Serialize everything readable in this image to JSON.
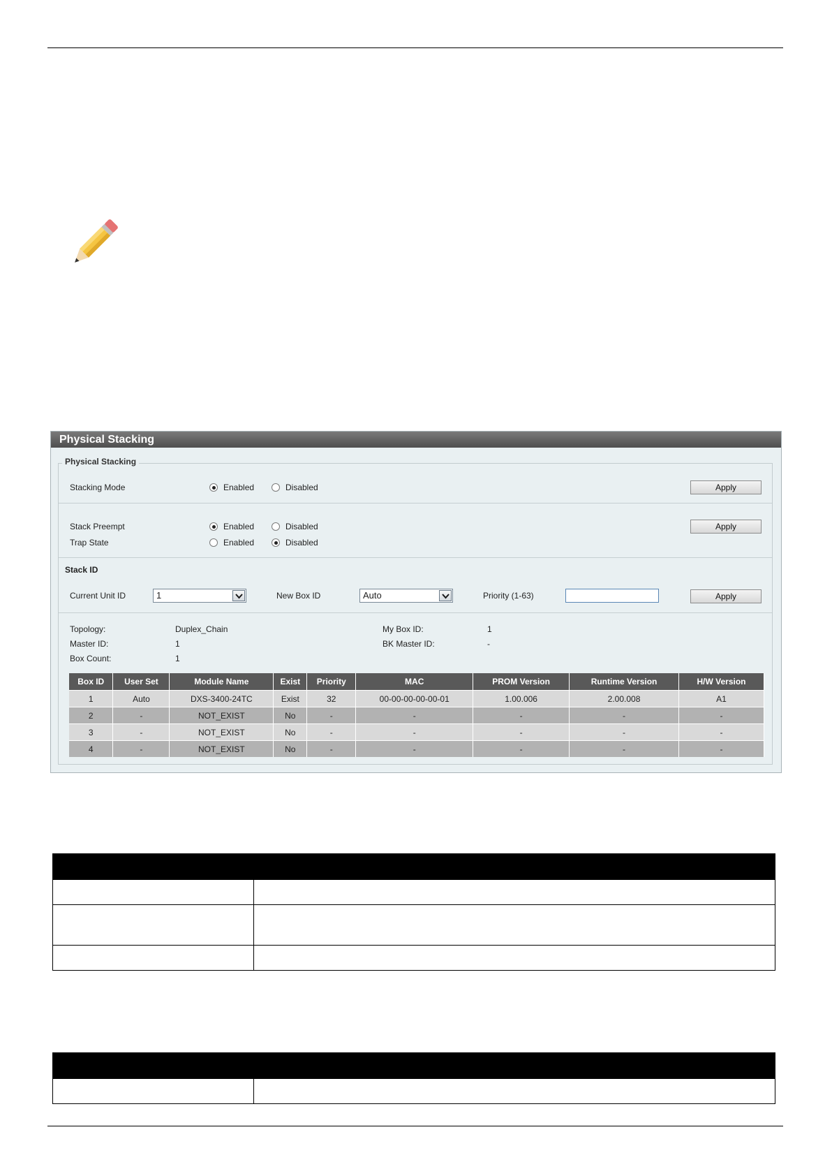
{
  "panel": {
    "title": "Physical Stacking",
    "legend": "Physical Stacking",
    "stacking_mode": {
      "label": "Stacking Mode",
      "enabled": "Enabled",
      "disabled": "Disabled",
      "selected": "Enabled",
      "apply": "Apply"
    },
    "stack_preempt": {
      "label": "Stack Preempt",
      "enabled": "Enabled",
      "disabled": "Disabled",
      "selected": "Enabled"
    },
    "trap_state": {
      "label": "Trap State",
      "enabled": "Enabled",
      "disabled": "Disabled",
      "selected": "Disabled"
    },
    "preempt_apply": "Apply",
    "stack_id": {
      "heading": "Stack ID",
      "current_unit_label": "Current Unit ID",
      "current_unit_value": "1",
      "new_box_label": "New Box ID",
      "new_box_value": "Auto",
      "priority_label": "Priority (1-63)",
      "priority_value": "",
      "apply": "Apply"
    },
    "info": {
      "topology_label": "Topology:",
      "topology_value": "Duplex_Chain",
      "master_label": "Master ID:",
      "master_value": "1",
      "box_count_label": "Box Count:",
      "box_count_value": "1",
      "my_box_label": "My Box ID:",
      "my_box_value": "1",
      "bk_master_label": "BK Master ID:",
      "bk_master_value": "-"
    },
    "table": {
      "headers": [
        "Box ID",
        "User Set",
        "Module Name",
        "Exist",
        "Priority",
        "MAC",
        "PROM Version",
        "Runtime Version",
        "H/W Version"
      ],
      "rows": [
        [
          "1",
          "Auto",
          "DXS-3400-24TC",
          "Exist",
          "32",
          "00-00-00-00-00-01",
          "1.00.006",
          "2.00.008",
          "A1"
        ],
        [
          "2",
          "-",
          "NOT_EXIST",
          "No",
          "-",
          "-",
          "-",
          "-",
          "-"
        ],
        [
          "3",
          "-",
          "NOT_EXIST",
          "No",
          "-",
          "-",
          "-",
          "-",
          "-"
        ],
        [
          "4",
          "-",
          "NOT_EXIST",
          "No",
          "-",
          "-",
          "-",
          "-",
          "-"
        ]
      ]
    }
  },
  "colors": {
    "panel_bg": "#e9f0f2",
    "header_bg": "#595959",
    "row_light": "#d9d9d9",
    "row_dark": "#b2b2b2"
  },
  "icons": {
    "note": "pencil-icon"
  }
}
